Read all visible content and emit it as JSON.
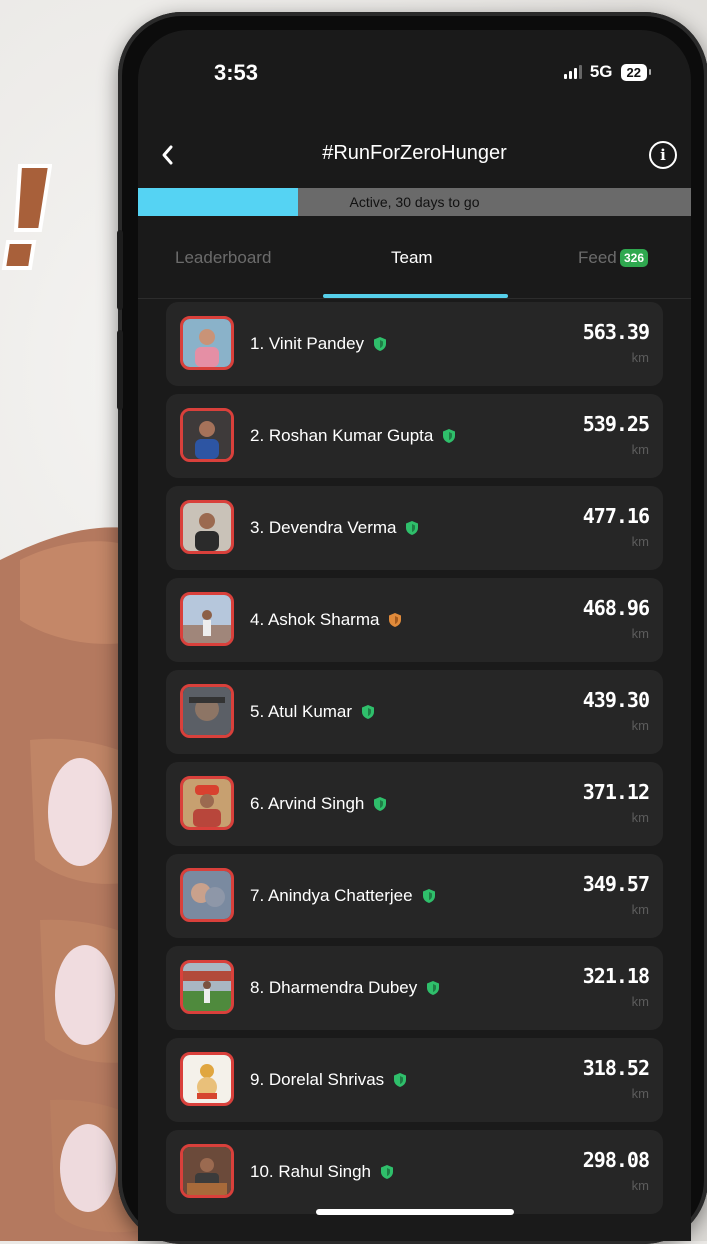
{
  "status_bar": {
    "time": "3:53",
    "network": "5G",
    "battery": "22"
  },
  "header": {
    "title": "#RunForZeroHunger",
    "back_icon": "chevron-left-icon",
    "info_icon": "info-icon"
  },
  "progress": {
    "label": "Active, 30 days to go",
    "fraction": 0.29
  },
  "tabs": [
    {
      "label": "Leaderboard",
      "active": false
    },
    {
      "label": "Team",
      "active": true
    },
    {
      "label": "Feed",
      "badge": "326",
      "active": false
    }
  ],
  "colors": {
    "accent": "#55d3f3",
    "shield_green": "#2fbf6b",
    "shield_orange": "#e08a3a",
    "avatar_border": "#d9403b",
    "badge_green": "#2fa84f"
  },
  "leaderboard": [
    {
      "rank_name": "1. Vinit Pandey",
      "distance": "563.39",
      "unit": "km",
      "shield": "green"
    },
    {
      "rank_name": "2. Roshan Kumar Gupta",
      "distance": "539.25",
      "unit": "km",
      "shield": "green"
    },
    {
      "rank_name": "3. Devendra Verma",
      "distance": "477.16",
      "unit": "km",
      "shield": "green"
    },
    {
      "rank_name": "4. Ashok Sharma",
      "distance": "468.96",
      "unit": "km",
      "shield": "orange"
    },
    {
      "rank_name": "5. Atul Kumar",
      "distance": "439.30",
      "unit": "km",
      "shield": "green"
    },
    {
      "rank_name": "6. Arvind Singh",
      "distance": "371.12",
      "unit": "km",
      "shield": "green"
    },
    {
      "rank_name": "7. Anindya Chatterjee",
      "distance": "349.57",
      "unit": "km",
      "shield": "green"
    },
    {
      "rank_name": "8. Dharmendra Dubey",
      "distance": "321.18",
      "unit": "km",
      "shield": "green"
    },
    {
      "rank_name": "9. Dorelal Shrivas",
      "distance": "318.52",
      "unit": "km",
      "shield": "green"
    },
    {
      "rank_name": "10. Rahul Singh",
      "distance": "298.08",
      "unit": "km",
      "shield": "green"
    }
  ]
}
